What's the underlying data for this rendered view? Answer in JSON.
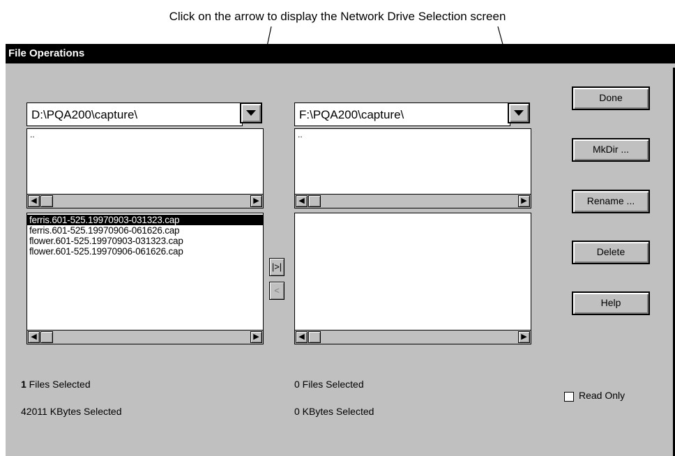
{
  "caption": "Click on the arrow to display the Network Drive Selection screen",
  "window": {
    "title": "File Operations"
  },
  "left": {
    "path": "D:\\PQA200\\capture\\",
    "dir_items": [
      ".."
    ],
    "files": [
      "ferris.601-525.19970903-031323.cap",
      "ferris.601-525.19970906-061626.cap",
      "flower.601-525.19970903-031323.cap",
      "flower.601-525.19970906-061626.cap"
    ],
    "selected_index": 0,
    "files_selected_count": "1",
    "files_selected_text": " Files Selected",
    "bytes_selected": "42011 KBytes Selected"
  },
  "right": {
    "path": "F:\\PQA200\\capture\\",
    "dir_items": [
      ".."
    ],
    "files": [],
    "files_selected": "0 Files Selected",
    "bytes_selected": "0 KBytes Selected"
  },
  "transfer": {
    "right_label": "|>|",
    "left_label": "<"
  },
  "buttons": {
    "done": "Done",
    "mkdir": "MkDir ...",
    "rename": "Rename ...",
    "delete": "Delete",
    "help": "Help"
  },
  "read_only": {
    "label": "Read Only",
    "checked": false
  },
  "icons": {
    "dropdown": "dropdown-arrow-icon",
    "scroll_left": "scroll-left-arrow-icon",
    "scroll_right": "scroll-right-arrow-icon",
    "callout": "callout-arrow-icon"
  }
}
